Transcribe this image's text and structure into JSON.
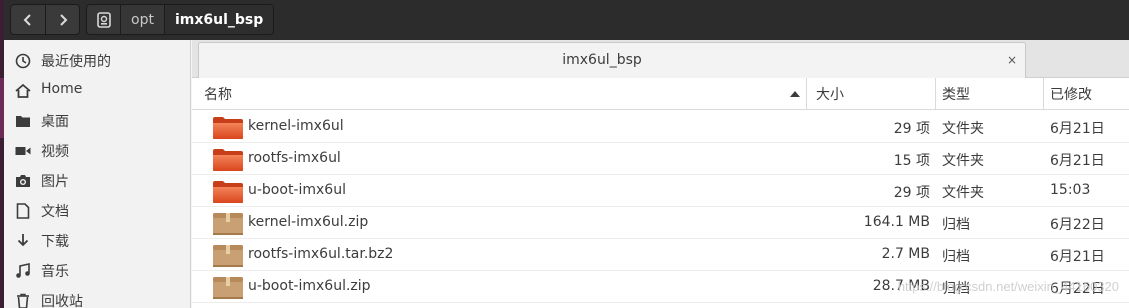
{
  "headerbar": {
    "back_icon": "chevron-left-icon",
    "forward_icon": "chevron-right-icon",
    "path": [
      {
        "label": "",
        "icon": "drive-icon"
      },
      {
        "label": "opt"
      },
      {
        "label": "imx6ul_bsp"
      }
    ]
  },
  "sidebar": {
    "items": [
      {
        "label": "最近使用的",
        "icon": "clock-icon"
      },
      {
        "label": "Home",
        "icon": "home-icon"
      },
      {
        "label": "桌面",
        "icon": "folder-icon"
      },
      {
        "label": "视频",
        "icon": "video-icon"
      },
      {
        "label": "图片",
        "icon": "camera-icon"
      },
      {
        "label": "文档",
        "icon": "document-icon"
      },
      {
        "label": "下载",
        "icon": "download-icon"
      },
      {
        "label": "音乐",
        "icon": "music-icon"
      },
      {
        "label": "回收站",
        "icon": "trash-icon"
      }
    ]
  },
  "tab": {
    "title": "imx6ul_bsp",
    "close_label": "×"
  },
  "columns": {
    "name": "名称",
    "size": "大小",
    "type": "类型",
    "modified": "已修改"
  },
  "files": [
    {
      "name": "kernel-imx6ul",
      "size": "29 项",
      "type": "文件夹",
      "modified": "6月21日",
      "kind": "folder"
    },
    {
      "name": "rootfs-imx6ul",
      "size": "15 项",
      "type": "文件夹",
      "modified": "6月21日",
      "kind": "folder"
    },
    {
      "name": "u-boot-imx6ul",
      "size": "29 项",
      "type": "文件夹",
      "modified": "15:03",
      "kind": "folder"
    },
    {
      "name": "kernel-imx6ul.zip",
      "size": "164.1 MB",
      "type": "归档",
      "modified": "6月22日",
      "kind": "archive"
    },
    {
      "name": "rootfs-imx6ul.tar.bz2",
      "size": "2.7 MB",
      "type": "归档",
      "modified": "6月21日",
      "kind": "archive"
    },
    {
      "name": "u-boot-imx6ul.zip",
      "size": "28.7 MB",
      "type": "归档",
      "modified": "6月22日",
      "kind": "archive"
    }
  ],
  "watermark": "https://blog.csdn.net/weixin_44160320",
  "colors": {
    "headerbar": "#2c2c2c",
    "folder": "#e8562a",
    "archive": "#c9a073",
    "accent_edge": "#3b1e33"
  }
}
